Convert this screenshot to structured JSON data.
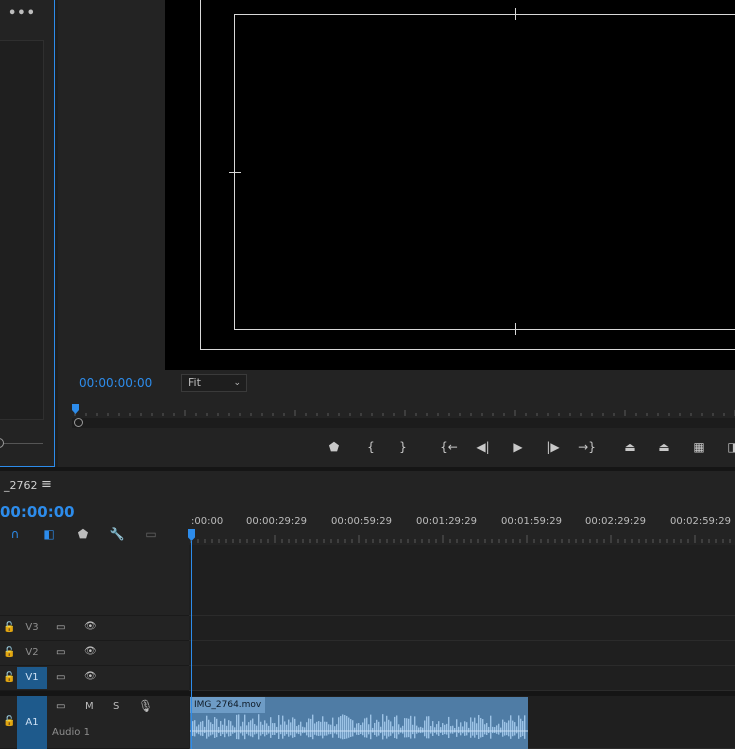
{
  "left_panel": {
    "more_label": "•••"
  },
  "monitor": {
    "timecode": "00:00:00:00",
    "fit": "Fit",
    "transport": [
      {
        "name": "add-marker-button",
        "glyph": "⬟"
      },
      {
        "name": "mark-in-button",
        "glyph": "{"
      },
      {
        "name": "mark-out-button",
        "glyph": "}"
      },
      {
        "name": "go-to-in-button",
        "glyph": "{←"
      },
      {
        "name": "step-back-button",
        "glyph": "◀|"
      },
      {
        "name": "play-button",
        "glyph": "▶"
      },
      {
        "name": "step-forward-button",
        "glyph": "|▶"
      },
      {
        "name": "go-to-out-button",
        "glyph": "→}"
      },
      {
        "name": "lift-button",
        "glyph": "⏏"
      },
      {
        "name": "extract-button",
        "glyph": "⏏"
      },
      {
        "name": "export-frame-button",
        "glyph": "▦"
      },
      {
        "name": "comparison-button",
        "glyph": "◨"
      }
    ]
  },
  "timeline": {
    "sequence_name": "_2762",
    "menu_glyph": "≡",
    "timecode": "00:00:00",
    "ruler_labels": [
      ":00:00",
      "00:00:29:29",
      "00:00:59:29",
      "00:01:29:29",
      "00:01:59:29",
      "00:02:29:29",
      "00:02:59:29"
    ],
    "tracks": {
      "v3": "V3",
      "v2": "V2",
      "v1": "V1",
      "a1": "A1",
      "a1_name": "Audio 1",
      "mute": "M",
      "solo": "S"
    },
    "clip": {
      "name": "IMG_2764.mov"
    }
  },
  "colors": {
    "accent": "#2d8ceb",
    "clip": "#4f7ca5",
    "clip_header": "#6e9cc6"
  }
}
